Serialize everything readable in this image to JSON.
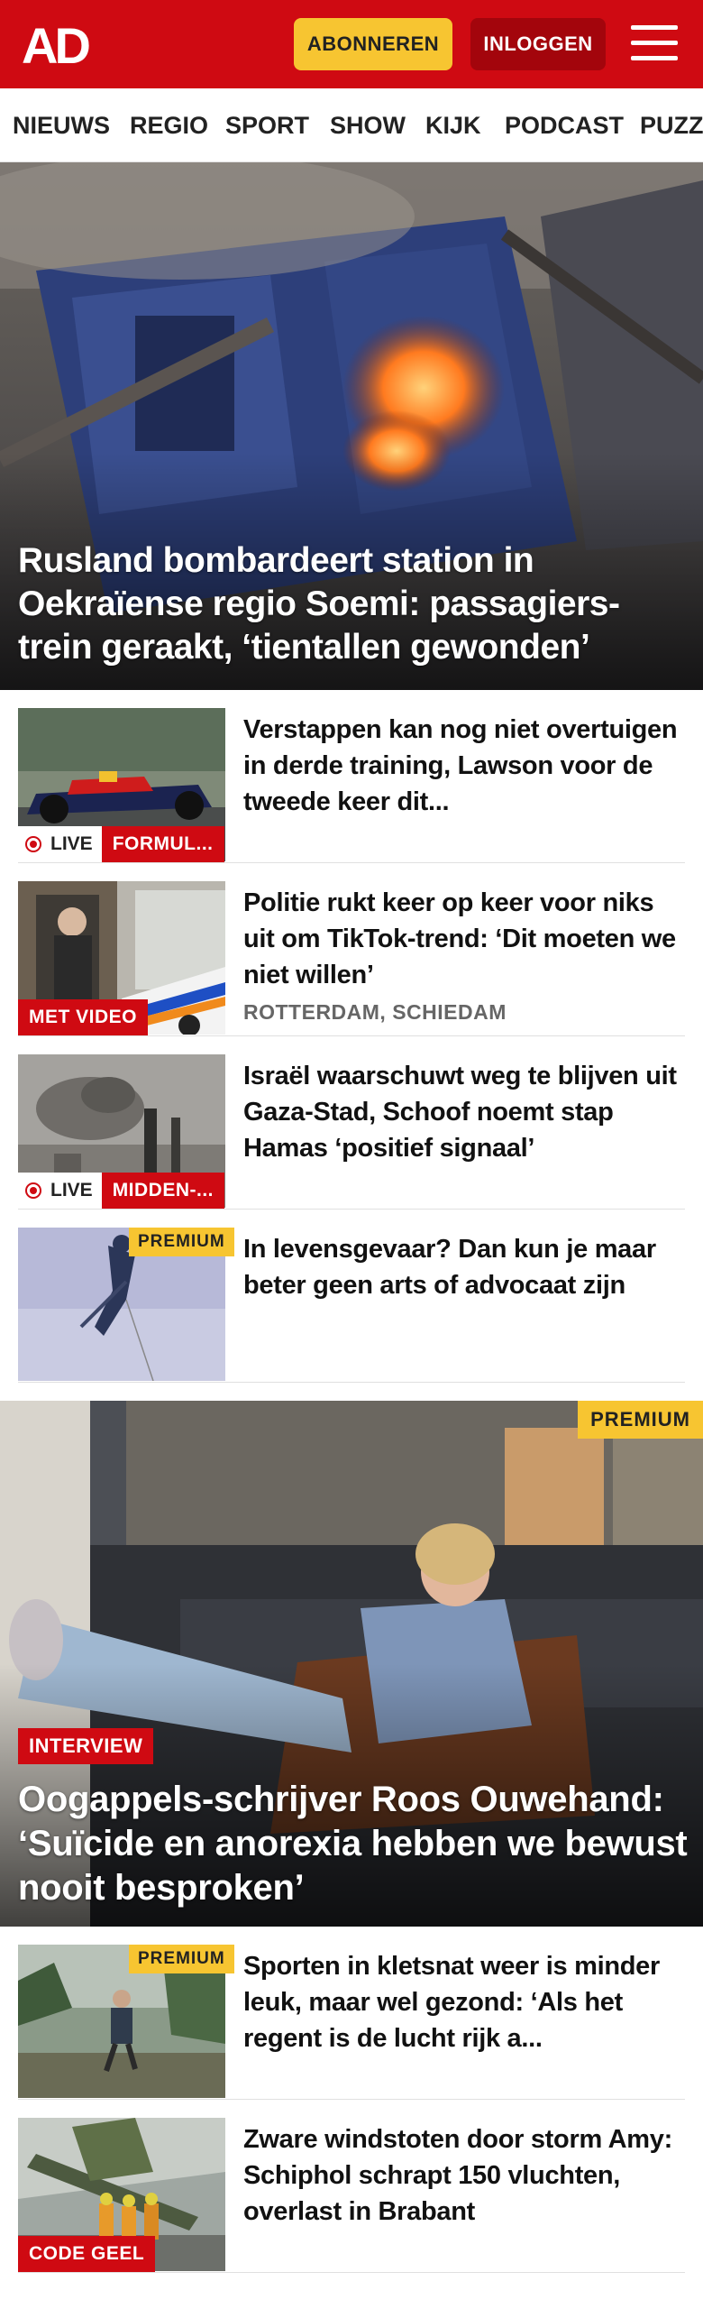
{
  "header": {
    "logo_text": "AD",
    "subscribe_label": "ABONNEREN",
    "login_label": "INLOGGEN",
    "menu_icon": "hamburger-menu-icon",
    "brand_color": "#cf0a12",
    "accent_color": "#f7c531"
  },
  "nav": {
    "items": [
      "NIEUWS",
      "REGIO",
      "SPORT",
      "SHOW",
      "KIJK",
      "PODCAST",
      "PUZZ"
    ]
  },
  "hero": {
    "title": "Rusland bombardeert station in Oekraïense regio Soemi: passagiers-trein geraakt, ‘tientallen gewonden’"
  },
  "articles": [
    {
      "title": "Verstappen kan nog niet overtuigen in derde training, Lawson voor de tweede keer dit...",
      "live_label": "LIVE",
      "category": "FORMUL..."
    },
    {
      "title": "Politie rukt keer op keer voor niks uit om TikTok-trend: ‘Dit moeten we niet willen’",
      "badge": "MET VIDEO",
      "location": "ROTTERDAM, SCHIEDAM"
    },
    {
      "title": "Israël waarschuwt weg te blijven uit Gaza-Stad, Schoof noemt stap Hamas ‘positief signaal’",
      "live_label": "LIVE",
      "category": "MIDDEN-..."
    },
    {
      "title": "In levensgevaar? Dan kun je maar beter geen arts of advocaat zijn",
      "premium": "PREMIUM"
    }
  ],
  "feature": {
    "premium": "PREMIUM",
    "tag": "INTERVIEW",
    "title": "Oogappels-schrijver Roos Ouwehand: ‘Suïcide en anorexia hebben we bewust nooit besproken’"
  },
  "articles2": [
    {
      "title": "Sporten in kletsnat weer is minder leuk, maar wel gezond: ‘Als het regent is de lucht rijk a...",
      "premium": "PREMIUM"
    },
    {
      "title": "Zware windstoten door storm Amy: Schiphol schrapt 150 vluchten, overlast in Brabant",
      "badge": "CODE GEEL"
    }
  ]
}
